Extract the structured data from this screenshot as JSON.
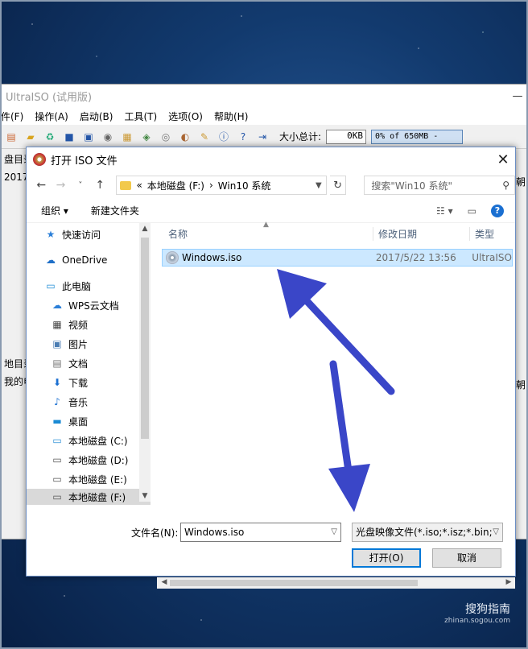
{
  "app": {
    "title": "UltraISO (试用版)",
    "menu": [
      "件(F)",
      "操作(A)",
      "启动(B)",
      "工具(T)",
      "选项(O)",
      "帮助(H)"
    ],
    "size_label": "大小总计:",
    "size_value": "0KB",
    "usage_text": "0% of 650MB -",
    "left_label_top": "盘目录",
    "left_date": "2017",
    "left_label_mid": "地目录",
    "left_tree_root": "我的电",
    "right_clip_1": "朝",
    "right_clip_2": "朝"
  },
  "dialog": {
    "title": "打开 ISO 文件",
    "close_glyph": "✕",
    "address": {
      "prefix": "«",
      "parts": [
        "本地磁盘 (F:)",
        "›",
        "Win10 系统"
      ]
    },
    "search_placeholder": "搜索\"Win10 系统\"",
    "toolbar": {
      "organize": "组织 ▾",
      "new_folder": "新建文件夹"
    },
    "nav_items": [
      {
        "label": "快速访问",
        "icon": "star-icon"
      },
      {
        "label": "OneDrive",
        "icon": "cloud-icon"
      },
      {
        "label": "此电脑",
        "icon": "computer-icon"
      },
      {
        "label": "WPS云文档",
        "icon": "cloud-outline-icon"
      },
      {
        "label": "视频",
        "icon": "video-icon"
      },
      {
        "label": "图片",
        "icon": "picture-icon"
      },
      {
        "label": "文档",
        "icon": "document-icon"
      },
      {
        "label": "下载",
        "icon": "download-icon"
      },
      {
        "label": "音乐",
        "icon": "music-icon"
      },
      {
        "label": "桌面",
        "icon": "desktop-icon"
      },
      {
        "label": "本地磁盘 (C:)",
        "icon": "drive-icon"
      },
      {
        "label": "本地磁盘 (D:)",
        "icon": "drive-icon"
      },
      {
        "label": "本地磁盘 (E:)",
        "icon": "drive-icon"
      },
      {
        "label": "本地磁盘 (F:)",
        "icon": "drive-icon"
      }
    ],
    "columns": {
      "name": "名称",
      "date": "修改日期",
      "type": "类型"
    },
    "files": [
      {
        "name": "Windows.iso",
        "date": "2017/5/22 13:56",
        "type": "UltraISO"
      }
    ],
    "filename_label": "文件名(N):",
    "filename_value": "Windows.iso",
    "filetype_value": "光盘映像文件(*.iso;*.isz;*.bin;*",
    "open_button": "打开(O)",
    "cancel_button": "取消"
  },
  "watermark": {
    "brand": "搜狗指南",
    "url": "zhinan.sogou.com"
  },
  "colors": {
    "arrow": "#3a46c8",
    "selection": "#cce8ff",
    "accent": "#0078d7"
  }
}
